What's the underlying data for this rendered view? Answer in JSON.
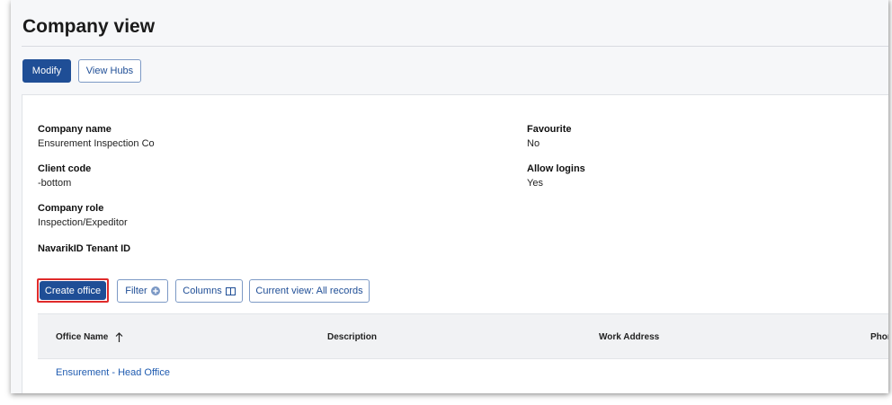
{
  "page": {
    "title": "Company view"
  },
  "toolbar": {
    "modify_label": "Modify",
    "view_hubs_label": "View Hubs"
  },
  "details": {
    "company_name_label": "Company name",
    "company_name_value": "Ensurement Inspection Co",
    "client_code_label": "Client code",
    "client_code_value": "-bottom",
    "company_role_label": "Company role",
    "company_role_value": "Inspection/Expeditor",
    "tenant_id_label": "NavarikID Tenant ID",
    "favourite_label": "Favourite",
    "favourite_value": "No",
    "allow_logins_label": "Allow logins",
    "allow_logins_value": "Yes"
  },
  "offices_toolbar": {
    "create_office_label": "Create office",
    "filter_label": "Filter",
    "columns_label": "Columns",
    "current_view_label": "Current view: All records"
  },
  "table": {
    "columns": [
      "Office Name",
      "Description",
      "Work Address",
      "Phon"
    ],
    "sort_column": "Office Name",
    "sort_direction": "ascending",
    "rows": [
      {
        "office_name": "Ensurement - Head Office"
      }
    ]
  },
  "colors": {
    "primary": "#1f4e96",
    "link": "#1f5bb0",
    "highlight": "#e02b2b"
  },
  "icons": {
    "filter": "plus-circle-icon",
    "columns": "columns-icon",
    "sort": "sort-ascending-arrow-icon"
  }
}
